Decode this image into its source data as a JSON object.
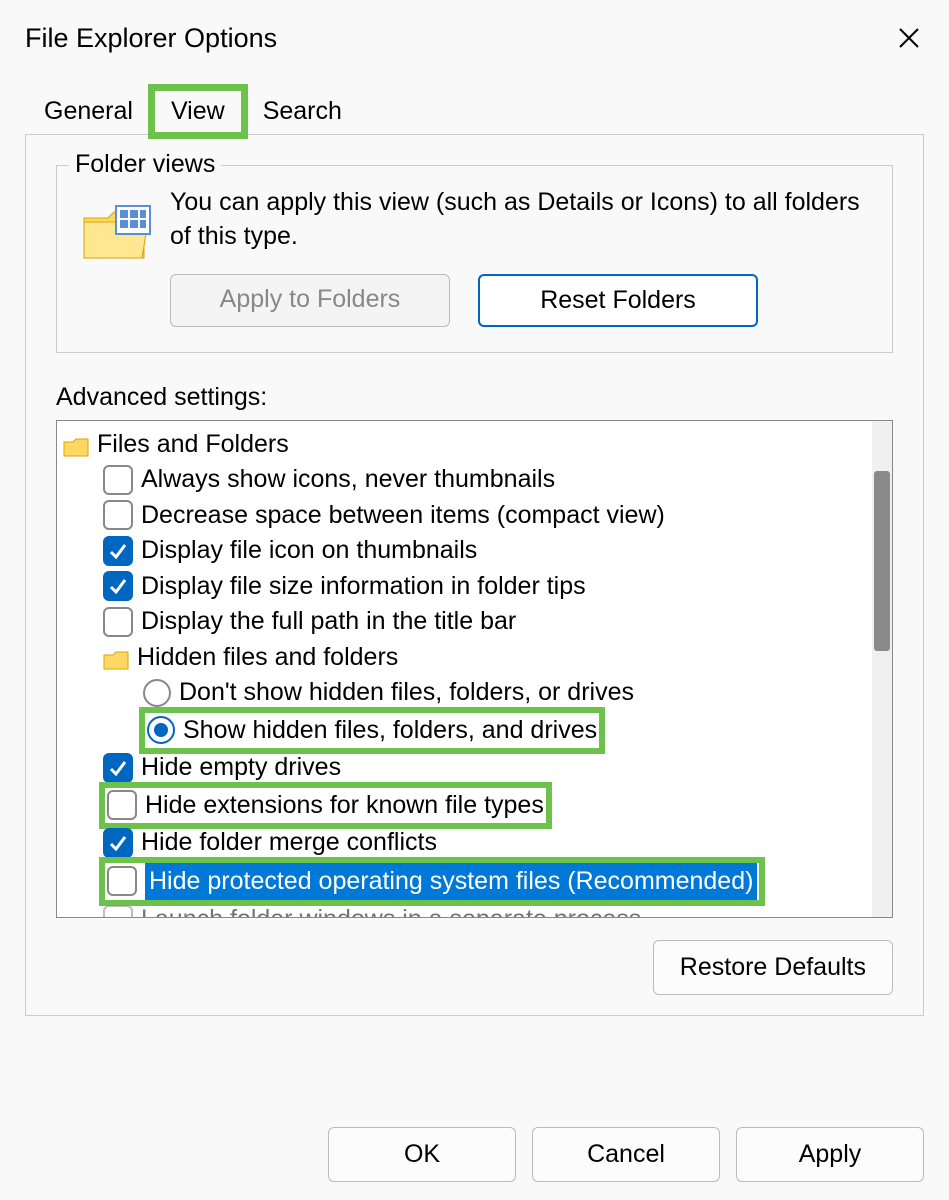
{
  "title": "File Explorer Options",
  "tabs": {
    "general": "General",
    "view": "View",
    "search": "Search",
    "active": "view"
  },
  "folderViews": {
    "groupTitle": "Folder views",
    "description": "You can apply this view (such as Details or Icons) to all folders of this type.",
    "applyButton": "Apply to Folders",
    "resetButton": "Reset Folders"
  },
  "advanced": {
    "label": "Advanced settings:",
    "rootLabel": "Files and Folders",
    "items": {
      "alwaysIcons": {
        "label": "Always show icons, never thumbnails",
        "checked": false
      },
      "compactView": {
        "label": "Decrease space between items (compact view)",
        "checked": false
      },
      "iconOnThumbs": {
        "label": "Display file icon on thumbnails",
        "checked": true
      },
      "sizeInTips": {
        "label": "Display file size information in folder tips",
        "checked": true
      },
      "fullPathTitle": {
        "label": "Display the full path in the title bar",
        "checked": false
      },
      "hiddenGroup": {
        "label": "Hidden files and folders"
      },
      "radioDontShow": {
        "label": "Don't show hidden files, folders, or drives",
        "selected": false
      },
      "radioShowHidden": {
        "label": "Show hidden files, folders, and drives",
        "selected": true
      },
      "hideEmpty": {
        "label": "Hide empty drives",
        "checked": true
      },
      "hideExt": {
        "label": "Hide extensions for known file types",
        "checked": false
      },
      "hideMerge": {
        "label": "Hide folder merge conflicts",
        "checked": true
      },
      "hideProtected": {
        "label": "Hide protected operating system files (Recommended)",
        "checked": false
      },
      "launchSeparate": {
        "label": "Launch folder windows in a separate process",
        "checked": false
      }
    }
  },
  "restoreButton": "Restore Defaults",
  "buttons": {
    "ok": "OK",
    "cancel": "Cancel",
    "apply": "Apply"
  }
}
